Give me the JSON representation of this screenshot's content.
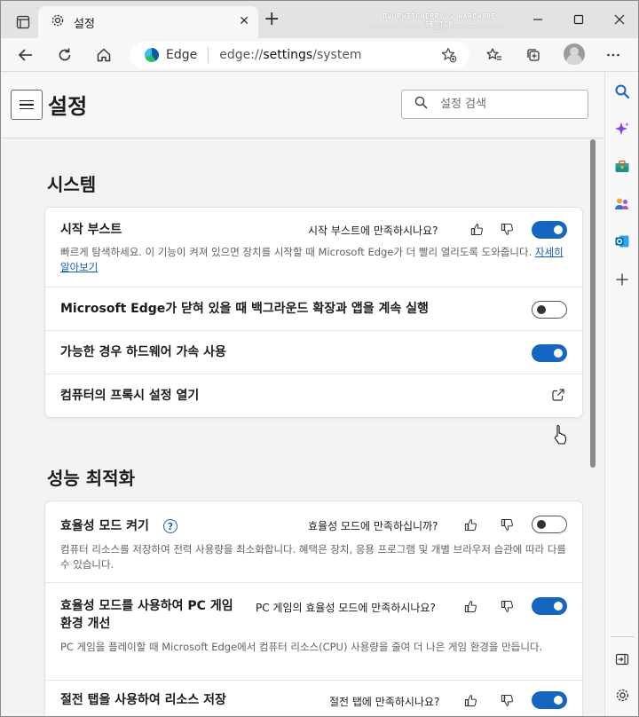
{
  "browser": {
    "tab_title": "설정",
    "watermark": "DVURWITCHERRY'S HARDWARE SECTOR",
    "watermark_sub": "ALL COPYRIGHT © 2010 DVURWITCHERRY'S HARDWARE SECTOR ALL RIGHTS RESERVED",
    "address": {
      "site": "Edge",
      "url_scheme": "edge://",
      "url_host": "settings",
      "url_path": "/system"
    }
  },
  "settings": {
    "title": "설정",
    "search_placeholder": "설정 검색"
  },
  "system": {
    "title": "시스템",
    "startup_boost": {
      "label": "시작 부스트",
      "feedback_question": "시작 부스트에 만족하시나요?",
      "description": "빠르게 탐색하세요. 이 기능이 켜져 있으면 장치를 시작할 때 Microsoft Edge가 더 빨리 열리도록 도와줍니다.",
      "learn_more": "자세히 알아보기",
      "enabled": true
    },
    "background_apps": {
      "label": "Microsoft Edge가 닫혀 있을 때 백그라운드 확장과 앱을 계속 실행",
      "enabled": false
    },
    "hardware_accel": {
      "label": "가능한 경우 하드웨어 가속 사용",
      "enabled": true
    },
    "proxy": {
      "label": "컴퓨터의 프록시 설정 열기"
    }
  },
  "performance": {
    "title": "성능 최적화",
    "efficiency_mode": {
      "label": "효율성 모드 켜기",
      "help": "?",
      "feedback_question": "효율성 모드에 만족하십니까?",
      "description": "컴퓨터 리소스를 저장하여 전력 사용량을 최소화합니다. 혜택은 장치, 응용 프로그램 및 개별 브라우저 습관에 따라 다를 수 있습니다.",
      "enabled": false
    },
    "pc_gaming": {
      "label_line1": "효율성 모드를 사용하여 PC 게임",
      "label_line2": "환경 개선",
      "feedback_question": "PC 게임의 효율성 모드에 만족하시나요?",
      "description": "PC 게임을 플레이할 때 Microsoft Edge에서 컴퓨터 리소스(CPU) 사용량을 줄여 더 나은 게임 환경을 만듭니다.",
      "enabled": true
    },
    "sleeping_tabs": {
      "label": "절전 탭을 사용하여 리소스 저장",
      "feedback_question": "절전 탭에 만족하시나요?",
      "enabled": true
    }
  },
  "colors": {
    "accent": "#1566c0",
    "link": "#0f5ebb"
  }
}
